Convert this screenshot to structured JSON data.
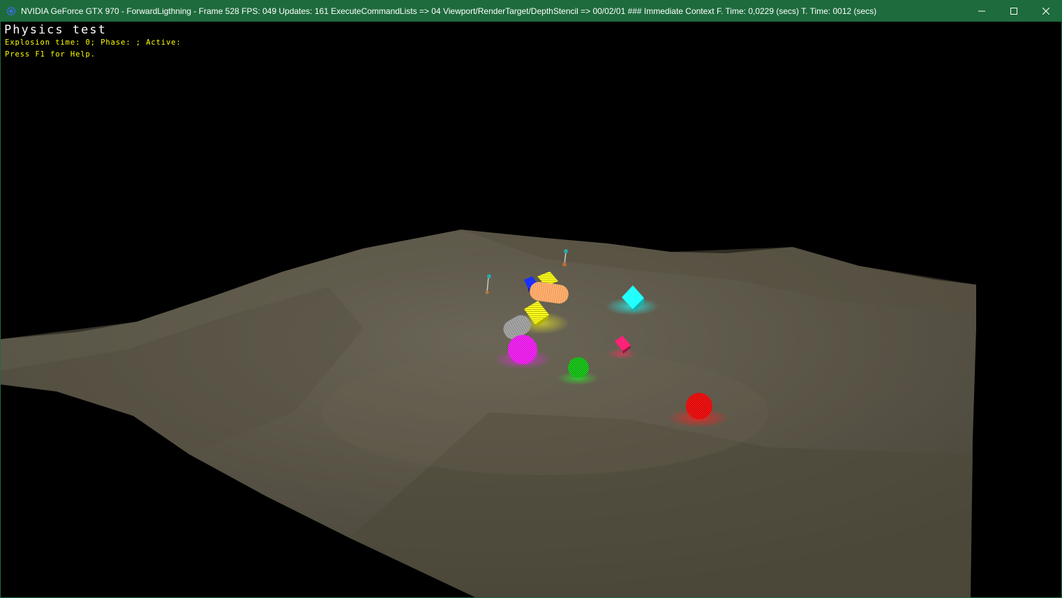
{
  "window": {
    "title": "NVIDIA GeForce GTX 970 - ForwardLigthning - Frame 528 FPS: 049 Updates: 161 ExecuteCommandLists => 04 Viewport/RenderTarget/DepthStencil => 00/02/01 ### Immediate Context F. Time: 0,0229 (secs) T. Time: 0012 (secs)",
    "icon": "gear-app-icon",
    "controls": [
      "minimize-icon",
      "maximize-icon",
      "close-icon"
    ],
    "titlebar_color": "#1e6b3d"
  },
  "hud": {
    "title": "Physics test",
    "status_line": "Explosion time: 0; Phase: ; Active:",
    "help_line": "Press F1 for Help.",
    "title_color": "#ffffff",
    "text_color": "#ffff00"
  },
  "scene": {
    "background_color": "#000000",
    "terrain_color": "#5b5648",
    "objects": [
      {
        "name": "red-sphere",
        "color": "#ff1a1a"
      },
      {
        "name": "green-sphere",
        "color": "#22dd22"
      },
      {
        "name": "magenta-sphere",
        "color": "#ff22ff"
      },
      {
        "name": "pink-cube",
        "color": "#ff2277"
      },
      {
        "name": "cyan-cube",
        "color": "#22ffff"
      },
      {
        "name": "yellow-cube",
        "color": "#ffff22"
      },
      {
        "name": "blue-cube",
        "color": "#2233ff"
      },
      {
        "name": "orange-capsule",
        "color": "#ffaa66"
      },
      {
        "name": "grey-cylinder",
        "color": "#999999"
      }
    ]
  }
}
